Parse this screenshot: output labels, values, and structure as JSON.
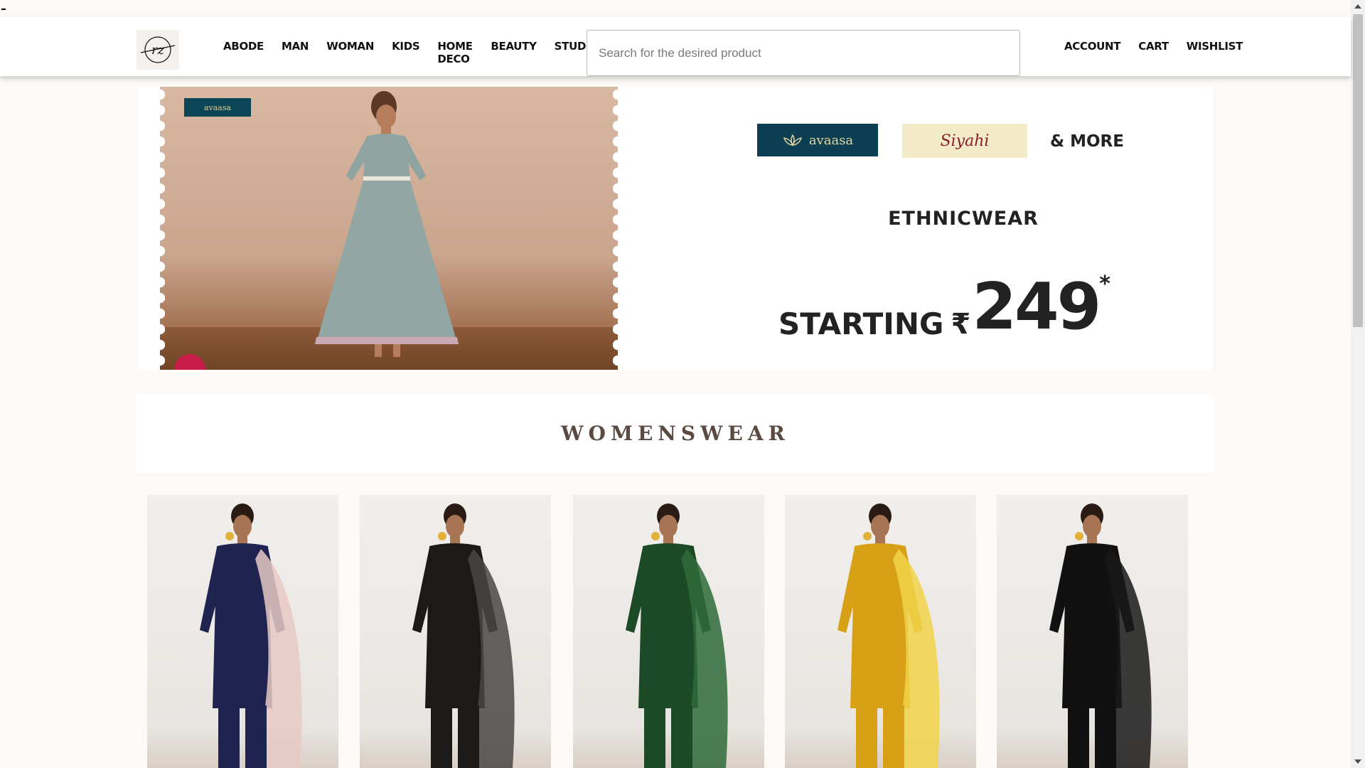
{
  "header": {
    "logo_text": "rz",
    "nav": [
      {
        "label": "ABODE"
      },
      {
        "label": "MAN"
      },
      {
        "label": "WOMAN"
      },
      {
        "label": "KIDS"
      },
      {
        "label": "HOME DECO"
      },
      {
        "label": "BEAUTY"
      },
      {
        "label": "STUDIO"
      }
    ],
    "search_placeholder": "Search for the desired product",
    "account_nav": [
      {
        "label": "ACCOUNT"
      },
      {
        "label": "CART"
      },
      {
        "label": "WISHLIST"
      }
    ]
  },
  "banner": {
    "stamp_badge": "avaasa",
    "brand_1": "avaasa",
    "brand_2": "Siyahi",
    "more": "& MORE",
    "category": "ETHNICWEAR",
    "starting": "STARTING",
    "currency": "₹",
    "price": "249",
    "asterisk": "*"
  },
  "section": {
    "title": "WOMENSWEAR"
  },
  "products": [
    {
      "outfit_color": "#1f2350",
      "dupatta_color": "#e8c9c3",
      "icon": "product-image"
    },
    {
      "outfit_color": "#1b1a19",
      "dupatta_color": "#4a4745",
      "icon": "product-image"
    },
    {
      "outfit_color": "#1d4a26",
      "dupatta_color": "#2f6b3a",
      "icon": "product-image"
    },
    {
      "outfit_color": "#d8a016",
      "dupatta_color": "#f1d34a",
      "icon": "product-image"
    },
    {
      "outfit_color": "#111111",
      "dupatta_color": "#1a1a1a",
      "icon": "product-image"
    }
  ],
  "colors": {
    "header_bg": "#ffffff",
    "page_bg": "#fcf9f6",
    "heading_color": "#5a4a42",
    "avaasa_bg": "#0c3f51",
    "siyahi_bg": "#f3ebc8"
  }
}
